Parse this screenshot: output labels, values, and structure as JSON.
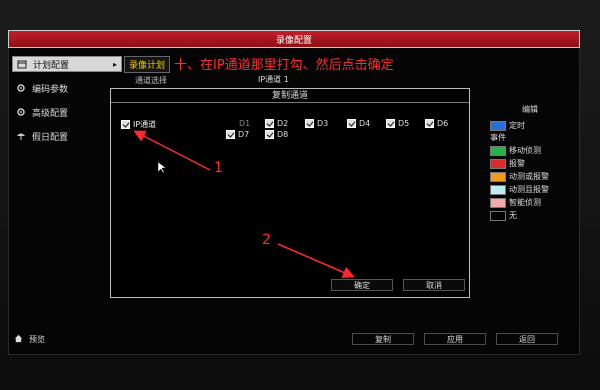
{
  "window": {
    "title": "录像配置"
  },
  "sidebar": {
    "items": [
      {
        "label": "计划配置",
        "icon": "calendar-icon",
        "active": true
      },
      {
        "label": "编码参数",
        "icon": "gear-icon",
        "active": false
      },
      {
        "label": "高级配置",
        "icon": "gear-icon",
        "active": false
      },
      {
        "label": "假日配置",
        "icon": "umbrella-icon",
        "active": false
      }
    ]
  },
  "tabs": {
    "active": "录像计划"
  },
  "annotation": {
    "instruction": "十、在IP通道那里打勾、然后点击确定",
    "marker_1": "1",
    "marker_2": "2",
    "color": "#ff2b2b"
  },
  "channel_select": {
    "label": "通道选择",
    "value": "IP通道 1"
  },
  "dialog": {
    "title": "复制通道",
    "ip_channel_label": "IP通道",
    "ip_channel_checked": true,
    "channels": [
      {
        "name": "D1",
        "checked": false
      },
      {
        "name": "D2",
        "checked": true
      },
      {
        "name": "D3",
        "checked": true
      },
      {
        "name": "D4",
        "checked": true
      },
      {
        "name": "D5",
        "checked": true
      },
      {
        "name": "D6",
        "checked": true
      },
      {
        "name": "D7",
        "checked": true
      },
      {
        "name": "D8",
        "checked": true
      }
    ],
    "ok_label": "确定",
    "cancel_label": "取消"
  },
  "legend": {
    "edit_label": "编辑",
    "scheduled_label": "定时",
    "event_header": "事件",
    "items": [
      {
        "label": "移动侦测",
        "color": "#27b34a"
      },
      {
        "label": "报警",
        "color": "#d92b2b"
      },
      {
        "label": "动测或报警",
        "color": "#f39c1a"
      },
      {
        "label": "动测且报警",
        "color": "#bfeef0"
      },
      {
        "label": "智能侦测",
        "color": "#f4a9a9"
      },
      {
        "label": "无",
        "color": "#000000"
      }
    ],
    "scheduled_color": "#2a6fd6"
  },
  "footer": {
    "preview_label": "预览",
    "copy_label": "复制",
    "apply_label": "应用",
    "back_label": "返回"
  }
}
